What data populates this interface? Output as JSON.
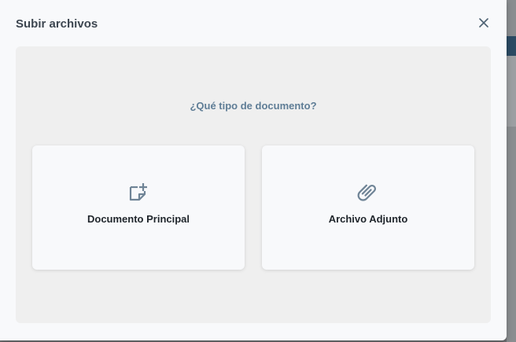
{
  "modal": {
    "title": "Subir archivos",
    "close_icon": "close-icon"
  },
  "panel": {
    "question": "¿Qué tipo de documento?",
    "options": [
      {
        "label": "Documento Principal",
        "icon": "document-add-icon"
      },
      {
        "label": "Archivo Adjunto",
        "icon": "paperclip-icon"
      }
    ]
  },
  "colors": {
    "icon": "#6f8496",
    "question": "#5f7d96",
    "panel_bg": "#efefef",
    "card_bg": "#f8f9fb"
  }
}
